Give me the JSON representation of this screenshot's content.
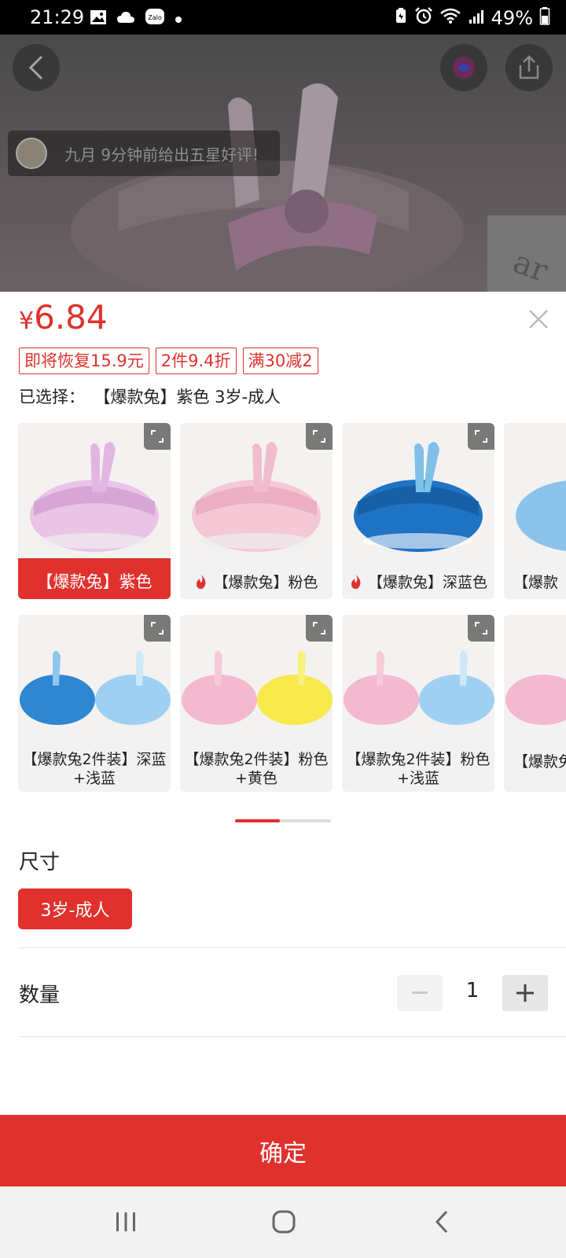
{
  "status_bar": {
    "time": "21:29",
    "battery": "49%",
    "left_icons": [
      "gallery-icon",
      "cloud-icon",
      "zalo-icon",
      "dot-icon"
    ],
    "right_icons": [
      "battery-saver-icon",
      "alarm-icon",
      "wifi-icon",
      "signal-icon",
      "battery-icon"
    ],
    "zalo_label": "Zalo"
  },
  "header": {
    "toast_text": "九月 9分钟前给出五星好评!"
  },
  "product": {
    "price_symbol": "¥",
    "price": "6.84",
    "tags": [
      "即将恢复15.9元",
      "2件9.4折",
      "满30减2"
    ],
    "selected_label": "已选择：",
    "selected_value": "【爆款兔】紫色 3岁-成人"
  },
  "variants": [
    {
      "label": "【爆款兔】紫色",
      "selected": true,
      "hot": false,
      "color": "#e9c4e6"
    },
    {
      "label": "【爆款兔】粉色",
      "selected": false,
      "hot": true,
      "color": "#f5c8d6"
    },
    {
      "label": "【爆款兔】深蓝色",
      "selected": false,
      "hot": true,
      "color": "#1f73c4"
    },
    {
      "label": "【爆款",
      "selected": false,
      "hot": false,
      "color": "#8cc3ea"
    },
    {
      "label": "【爆款兔2件装】深蓝+浅蓝",
      "selected": false,
      "hot": false,
      "color": "#2f86d1"
    },
    {
      "label": "【爆款兔2件装】粉色+黄色",
      "selected": false,
      "hot": false,
      "color": "#f3b9ce"
    },
    {
      "label": "【爆款兔2件装】粉色+浅蓝",
      "selected": false,
      "hot": false,
      "color": "#f3b9ce"
    },
    {
      "label": "【爆款兔",
      "selected": false,
      "hot": false,
      "color": "#f3b9ce"
    }
  ],
  "size": {
    "title": "尺寸",
    "option": "3岁-成人"
  },
  "quantity": {
    "label": "数量",
    "value": "1"
  },
  "confirm_label": "确定",
  "colors": {
    "accent": "#e0312d"
  }
}
